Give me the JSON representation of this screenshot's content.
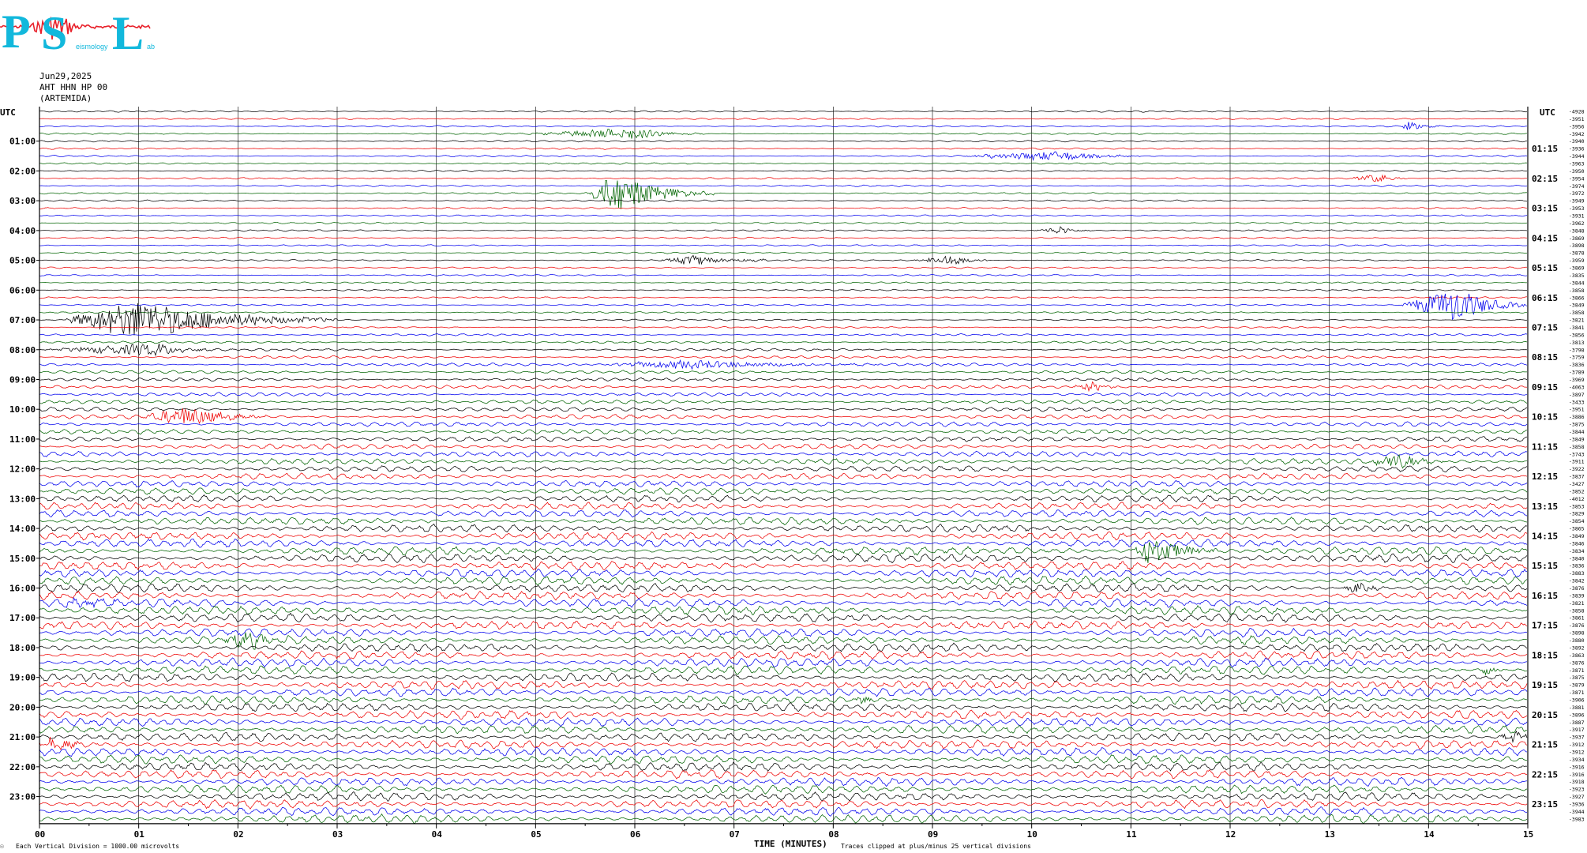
{
  "logo": {
    "letters": [
      "P",
      "S",
      "L"
    ],
    "small_text": [
      "eismology",
      "ab"
    ],
    "colors": {
      "letters": "#12b8dc",
      "wave": "#e8202a"
    }
  },
  "header": {
    "date": "Jun29,2025",
    "station": "AHT HHN HP 00",
    "location": "(ARTEMIDA)"
  },
  "footer": {
    "corner_mark": "☉",
    "scale": "Each Vertical Division = 1000.00 microvolts",
    "clip_note": "Traces clipped at plus/minus 25 vertical divisions"
  },
  "chart_data": {
    "type": "line",
    "title": "",
    "xlabel": "TIME (MINUTES)",
    "ylabel": "",
    "xlim": [
      0,
      15
    ],
    "x_ticks": [
      "00",
      "01",
      "02",
      "03",
      "04",
      "05",
      "06",
      "07",
      "08",
      "09",
      "10",
      "11",
      "12",
      "13",
      "14",
      "15"
    ],
    "y_corner_labels": {
      "left": "UTC",
      "right": "UTC"
    },
    "left_hour_labels": [
      "01:00",
      "02:00",
      "03:00",
      "04:00",
      "05:00",
      "06:00",
      "07:00",
      "08:00",
      "09:00",
      "10:00",
      "11:00",
      "12:00",
      "13:00",
      "14:00",
      "15:00",
      "16:00",
      "17:00",
      "18:00",
      "19:00",
      "20:00",
      "21:00",
      "22:00",
      "23:00"
    ],
    "right_hour_labels": [
      "01:15",
      "02:15",
      "03:15",
      "04:15",
      "05:15",
      "06:15",
      "07:15",
      "08:15",
      "09:15",
      "10:15",
      "11:15",
      "12:15",
      "13:15",
      "14:15",
      "15:15",
      "16:15",
      "17:15",
      "18:15",
      "19:15",
      "20:15",
      "21:15",
      "22:15",
      "23:15"
    ],
    "trace_minutes": 15,
    "trace_count": 96,
    "trace_colors": [
      "#000000",
      "#ee0000",
      "#0000ee",
      "#006400"
    ],
    "right_offsets": [
      -4928,
      -3951,
      -3956,
      -3942,
      -3940,
      -3936,
      -3944,
      -3963,
      -3950,
      -3954,
      -3974,
      -3972,
      -3949,
      -3953,
      -3931,
      -3962,
      -3848,
      -3869,
      -3898,
      -3878,
      -3959,
      -3869,
      -3835,
      -3844,
      -3858,
      -3866,
      -3849,
      -3858,
      -3821,
      -3841,
      -3856,
      -3813,
      -3798,
      -3759,
      -3836,
      -3789,
      -3969,
      -4063,
      -3897,
      -3433,
      -3951,
      -3886,
      -3875,
      -3844,
      -3849,
      -3858,
      -3743,
      -3911,
      -3922,
      -3837,
      -3427,
      -3852,
      -4012,
      -3853,
      -3829,
      -3854,
      -3865,
      -3849,
      -3846,
      -3834,
      -3840,
      -3836,
      -3883,
      -3842,
      -3876,
      -3839,
      -3821,
      -3858,
      -3861,
      -3876,
      -3898,
      -3880,
      -3892,
      -3863,
      -3876,
      -3871,
      -3875,
      -3879,
      -3871,
      -3906,
      -3881,
      -3896,
      -3887,
      -3917,
      -3937,
      -3912,
      -3912,
      -3934,
      -3916,
      -3916,
      -3918,
      -3923,
      -3927,
      -3936,
      -3944,
      -3983
    ],
    "events": [
      {
        "row": 3,
        "start_min": 4.9,
        "end_min": 6.7,
        "peak_min": 6.0,
        "amplitude": 1.6
      },
      {
        "row": 6,
        "start_min": 9.2,
        "end_min": 11.1,
        "peak_min": 10.3,
        "amplitude": 1.3
      },
      {
        "row": 2,
        "start_min": 13.7,
        "end_min": 14.1,
        "peak_min": 13.8,
        "amplitude": 1.4
      },
      {
        "row": 9,
        "start_min": 13.2,
        "end_min": 13.8,
        "peak_min": 13.5,
        "amplitude": 1.3
      },
      {
        "row": 11,
        "start_min": 5.5,
        "end_min": 6.8,
        "peak_min": 5.8,
        "amplitude": 5.5
      },
      {
        "row": 16,
        "start_min": 10.0,
        "end_min": 10.6,
        "peak_min": 10.3,
        "amplitude": 1.2
      },
      {
        "row": 20,
        "start_min": 6.2,
        "end_min": 7.4,
        "peak_min": 6.6,
        "amplitude": 1.4
      },
      {
        "row": 20,
        "start_min": 8.8,
        "end_min": 9.6,
        "peak_min": 9.2,
        "amplitude": 1.5
      },
      {
        "row": 26,
        "start_min": 13.7,
        "end_min": 15.0,
        "peak_min": 14.3,
        "amplitude": 5.0
      },
      {
        "row": 28,
        "start_min": 0.2,
        "end_min": 3.0,
        "peak_min": 1.0,
        "amplitude": 5.5
      },
      {
        "row": 32,
        "start_min": 0.0,
        "end_min": 1.8,
        "peak_min": 1.2,
        "amplitude": 1.8
      },
      {
        "row": 34,
        "start_min": 5.5,
        "end_min": 8.5,
        "peak_min": 6.6,
        "amplitude": 1.3
      },
      {
        "row": 37,
        "start_min": 10.4,
        "end_min": 10.9,
        "peak_min": 10.6,
        "amplitude": 1.5
      },
      {
        "row": 41,
        "start_min": 1.0,
        "end_min": 2.3,
        "peak_min": 1.5,
        "amplitude": 2.8
      },
      {
        "row": 47,
        "start_min": 13.3,
        "end_min": 14.2,
        "peak_min": 13.7,
        "amplitude": 2.2
      },
      {
        "row": 59,
        "start_min": 11.0,
        "end_min": 11.9,
        "peak_min": 11.2,
        "amplitude": 4.2
      },
      {
        "row": 64,
        "start_min": 13.1,
        "end_min": 13.6,
        "peak_min": 13.3,
        "amplitude": 1.5
      },
      {
        "row": 66,
        "start_min": 0.1,
        "end_min": 0.9,
        "peak_min": 0.5,
        "amplitude": 1.6
      },
      {
        "row": 71,
        "start_min": 1.8,
        "end_min": 2.6,
        "peak_min": 2.1,
        "amplitude": 2.0
      },
      {
        "row": 75,
        "start_min": 14.5,
        "end_min": 14.8,
        "peak_min": 14.6,
        "amplitude": 1.4
      },
      {
        "row": 79,
        "start_min": 8.2,
        "end_min": 8.4,
        "peak_min": 8.3,
        "amplitude": 1.5
      },
      {
        "row": 84,
        "start_min": 14.7,
        "end_min": 15.0,
        "peak_min": 14.9,
        "amplitude": 1.8
      },
      {
        "row": 85,
        "start_min": 0.0,
        "end_min": 0.6,
        "peak_min": 0.1,
        "amplitude": 2.0
      }
    ]
  }
}
